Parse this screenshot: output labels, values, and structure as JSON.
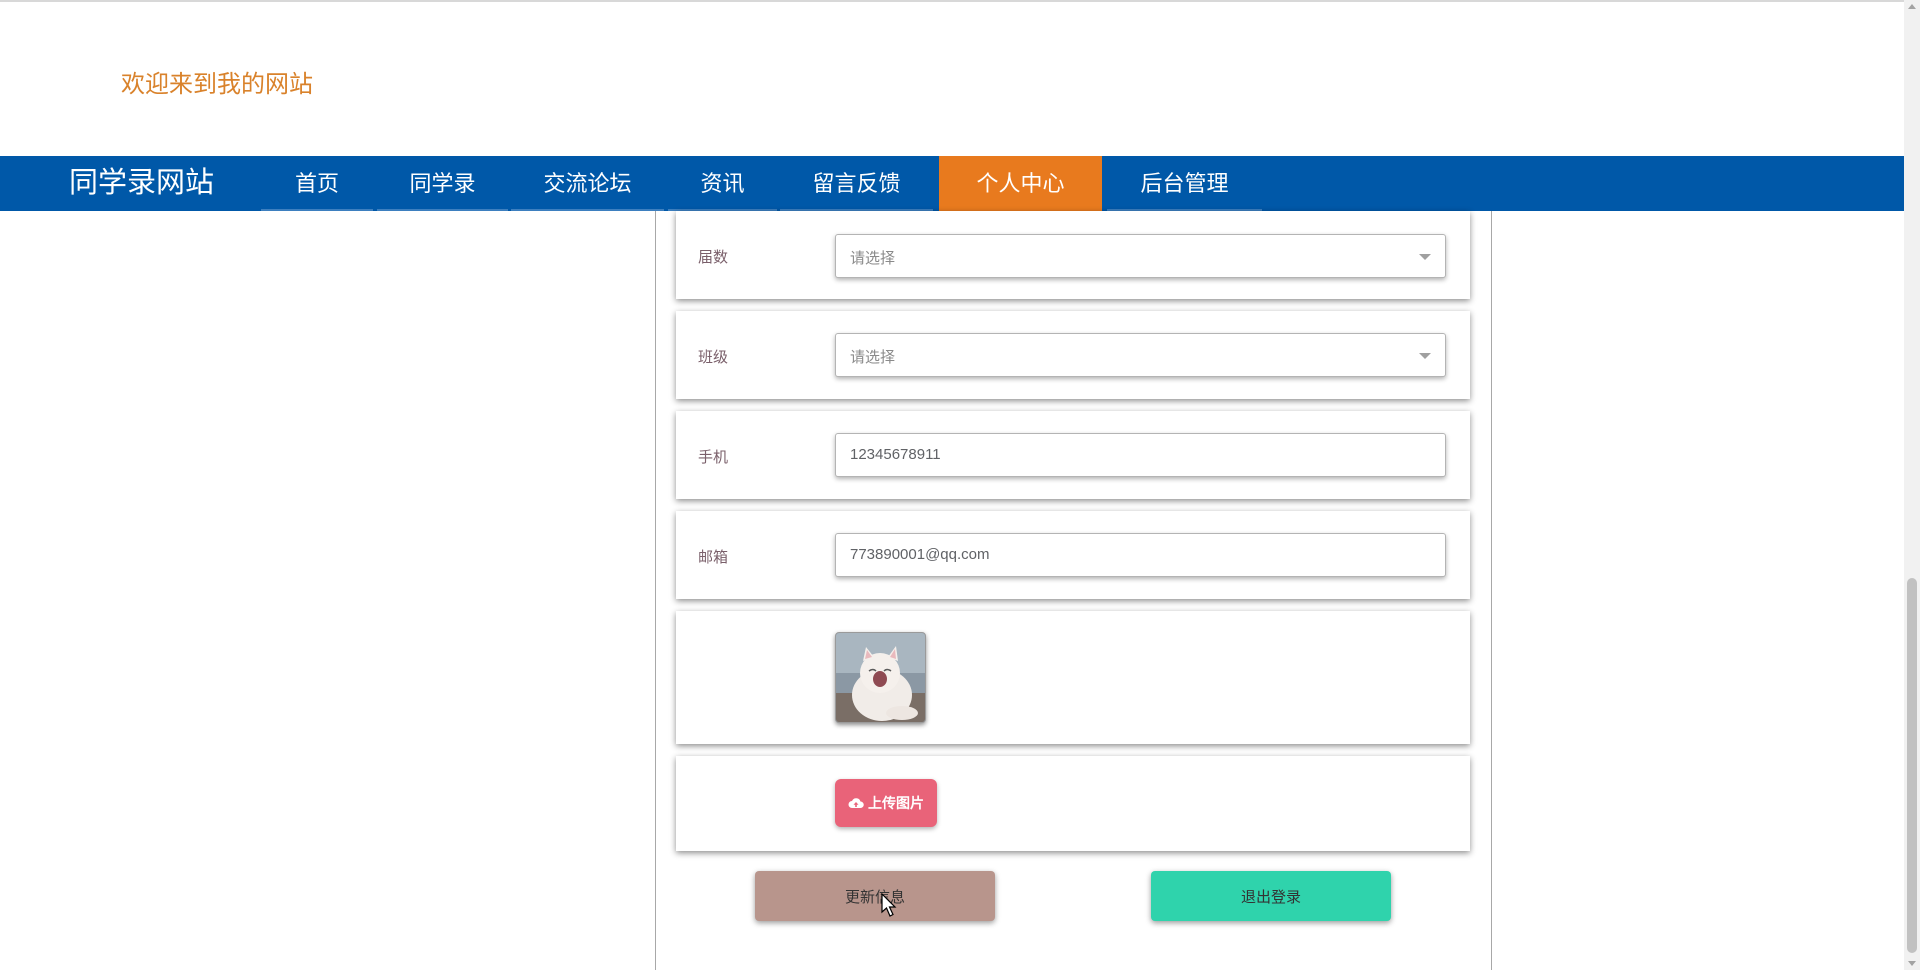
{
  "header": {
    "welcome_text": "欢迎来到我的网站"
  },
  "navbar": {
    "brand": "同学录网站",
    "items": [
      {
        "label": "首页",
        "active": false
      },
      {
        "label": "同学录",
        "active": false
      },
      {
        "label": "交流论坛",
        "active": false
      },
      {
        "label": "资讯",
        "active": false
      },
      {
        "label": "留言反馈",
        "active": false
      },
      {
        "label": "个人中心",
        "active": true
      },
      {
        "label": "后台管理",
        "active": false
      }
    ],
    "colors": {
      "background": "#0058a8",
      "active": "#e87a1e"
    }
  },
  "form": {
    "session": {
      "label": "届数",
      "placeholder": "请选择"
    },
    "class": {
      "label": "班级",
      "placeholder": "请选择"
    },
    "phone": {
      "label": "手机",
      "value": "12345678911"
    },
    "email": {
      "label": "邮箱",
      "value": "773890001@qq.com"
    },
    "avatar": {
      "alt": "cat-photo"
    },
    "upload": {
      "label": "上传图片",
      "icon": "cloud-upload-icon",
      "color": "#e96379"
    }
  },
  "actions": {
    "update_label": "更新信息",
    "logout_label": "退出登录",
    "colors": {
      "update": "#b8958c",
      "logout": "#2fd3ac"
    }
  }
}
